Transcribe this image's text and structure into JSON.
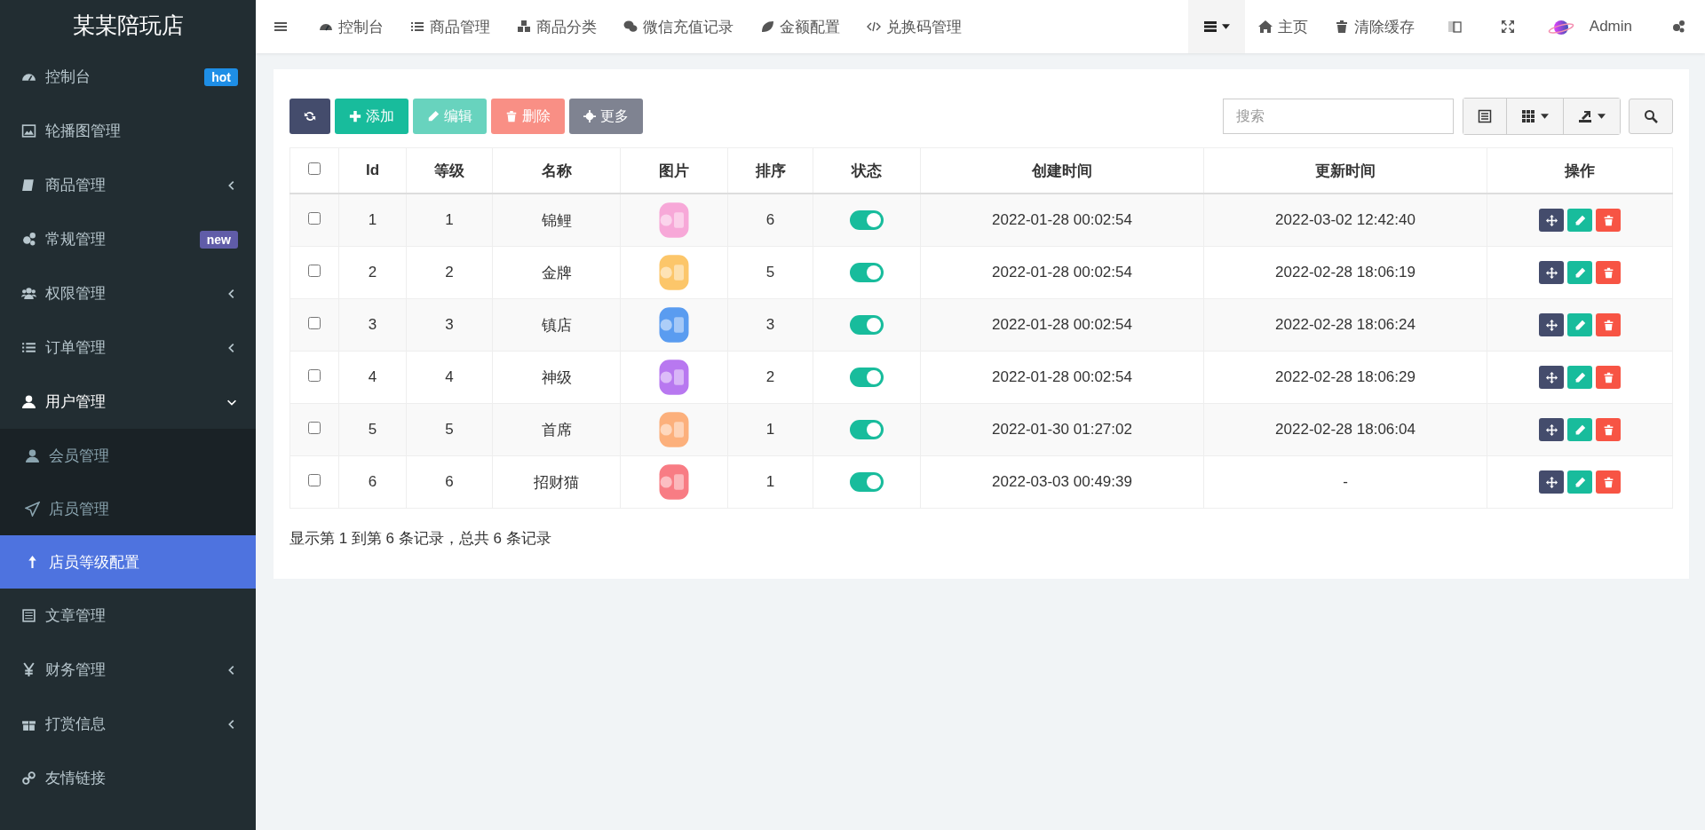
{
  "app": {
    "title": "某某陪玩店"
  },
  "sidebar": {
    "items": [
      {
        "kind": "link",
        "label": "控制台",
        "badge": {
          "text": "hot",
          "color": "#1e8ee6"
        },
        "selected": false
      },
      {
        "kind": "link",
        "label": "轮播图管理",
        "selected": false
      },
      {
        "kind": "group",
        "label": "商品管理",
        "expanded": false,
        "selected": false
      },
      {
        "kind": "link",
        "label": "常规管理",
        "badge": {
          "text": "new",
          "color": "#605ca8"
        },
        "selected": false
      },
      {
        "kind": "group",
        "label": "权限管理",
        "expanded": false,
        "selected": false
      },
      {
        "kind": "group",
        "label": "订单管理",
        "expanded": false,
        "selected": false
      },
      {
        "kind": "group",
        "label": "用户管理",
        "expanded": true,
        "selected": false,
        "children": [
          {
            "label": "会员管理",
            "selected": false
          },
          {
            "label": "店员管理",
            "selected": false
          },
          {
            "label": "店员等级配置",
            "selected": true
          }
        ]
      },
      {
        "kind": "link",
        "label": "文章管理",
        "selected": false
      },
      {
        "kind": "group",
        "label": "财务管理",
        "expanded": false,
        "selected": false
      },
      {
        "kind": "group",
        "label": "打赏信息",
        "expanded": false,
        "selected": false
      },
      {
        "kind": "link",
        "label": "友情链接",
        "selected": false
      }
    ]
  },
  "topnav": {
    "items": [
      "控制台",
      "商品管理",
      "商品分类",
      "微信充值记录",
      "金额配置",
      "兑换码管理"
    ],
    "right": {
      "home": "主页",
      "clear_cache": "清除缓存",
      "user": "Admin"
    }
  },
  "toolbar": {
    "buttons": [
      {
        "kind": "refresh",
        "disabled": false
      },
      {
        "kind": "add",
        "label": "添加",
        "disabled": false
      },
      {
        "kind": "edit",
        "label": "编辑",
        "disabled": true
      },
      {
        "kind": "delete",
        "label": "删除",
        "disabled": true
      },
      {
        "kind": "more",
        "label": "更多",
        "disabled": false
      }
    ],
    "search": {
      "placeholder": "搜索"
    }
  },
  "table": {
    "select_all_checked": false,
    "columns": [
      "Id",
      "等级",
      "名称",
      "图片",
      "排序",
      "状态",
      "创建时间",
      "更新时间",
      "操作"
    ],
    "rows": [
      {
        "checked": false,
        "id": "1",
        "level": "1",
        "name": "锦鲤",
        "color": "#f7a8d8",
        "sort": "6",
        "on": true,
        "created": "2022-01-28 00:02:54",
        "updated": "2022-03-02 12:42:40"
      },
      {
        "checked": false,
        "id": "2",
        "level": "2",
        "name": "金牌",
        "color": "#fcc66a",
        "sort": "5",
        "on": true,
        "created": "2022-01-28 00:02:54",
        "updated": "2022-02-28 18:06:19"
      },
      {
        "checked": false,
        "id": "3",
        "level": "3",
        "name": "镇店",
        "color": "#5a9cf0",
        "sort": "3",
        "on": true,
        "created": "2022-01-28 00:02:54",
        "updated": "2022-02-28 18:06:24"
      },
      {
        "checked": false,
        "id": "4",
        "level": "4",
        "name": "神级",
        "color": "#b878f0",
        "sort": "2",
        "on": true,
        "created": "2022-01-28 00:02:54",
        "updated": "2022-02-28 18:06:29"
      },
      {
        "checked": false,
        "id": "5",
        "level": "5",
        "name": "首席",
        "color": "#fcb07c",
        "sort": "1",
        "on": true,
        "created": "2022-01-30 01:27:02",
        "updated": "2022-02-28 18:06:04"
      },
      {
        "checked": false,
        "id": "6",
        "level": "6",
        "name": "招财猫",
        "color": "#f87c84",
        "sort": "1",
        "on": true,
        "created": "2022-03-03 00:49:39",
        "updated": "-"
      }
    ]
  },
  "pagination": {
    "summary": "显示第 1 到第 6 条记录，总共 6 条记录"
  }
}
